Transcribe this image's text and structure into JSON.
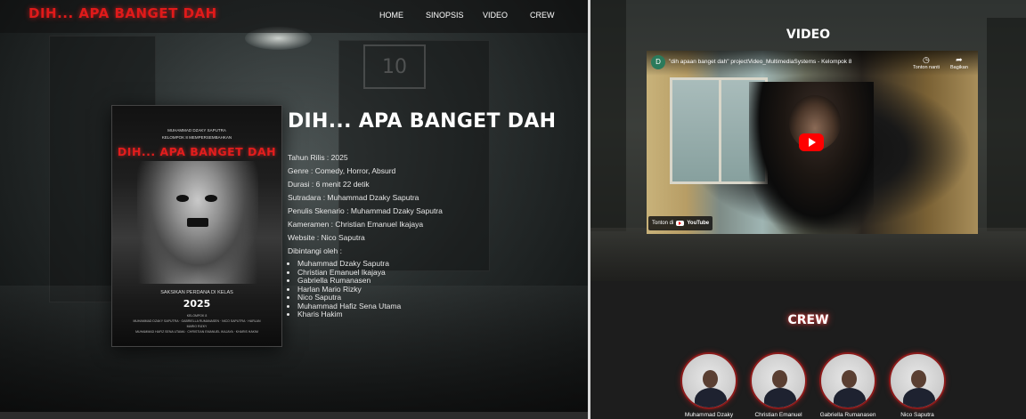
{
  "header": {
    "logo": "DIH... APA BANGET DAH",
    "nav": [
      "HOME",
      "SINOPSIS",
      "VIDEO",
      "CREW"
    ]
  },
  "corridor_sign": "10",
  "poster": {
    "top_line_1": "MUHAMMAD DZAKY SAPUTRA",
    "top_line_2": "KELOMPOK 8 MEMPERSEMBAHKAN",
    "title": "DIH... APA BANGET DAH",
    "subtitle": "SAKSIKAN PERDANA DI KELAS",
    "year": "2025",
    "credits_1": "KELOMPOK 8",
    "credits_2": "MUHAMMAD DZAKY SAPUTRA · GABRIELLA RUMANASEN · NICO SAPUTRA · HARLAN MARIO RIZKY",
    "credits_3": "MUHAMMAD HAFIZ SENA UTAMA · CHRISTIAN EMANUEL IKAJAYA · KHARIS HAKIM"
  },
  "film": {
    "title": "DIH... APA BANGET DAH",
    "details": [
      "Tahun Rilis : 2025",
      "Genre : Comedy, Horror, Absurd",
      "Durasi : 6 menit 22 detik",
      "Sutradara : Muhammad Dzaky Saputra",
      "Penulis Skenario : Muhammad Dzaky Saputra",
      "Kameramen : Christian Emanuel Ikajaya",
      "Website : Nico Saputra",
      "Dibintangi oleh :"
    ],
    "cast": [
      "Muhammad Dzaky Saputra",
      "Christian Emanuel Ikajaya",
      "Gabriella Rumanasen",
      "Harlan Mario Rizky",
      "Nico Saputra",
      "Muhammad Hafiz Sena Utama",
      "Kharis Hakim"
    ]
  },
  "video": {
    "heading": "VIDEO",
    "channel_initial": "D",
    "title": "\"dih apaan banget dah\" projectVideo_MultimediaSystems - Kelompok 8",
    "watch_later": "Tonton nanti",
    "share": "Bagikan",
    "watch_on": "Tonton di",
    "youtube": "YouTube"
  },
  "crew": {
    "heading": "CREW",
    "members": [
      "Muhammad Dzaky",
      "Christian Emanuel",
      "Gabriella Rumanasen",
      "Nico Saputra"
    ]
  },
  "colors": {
    "logo_red": "#e01a1a",
    "youtube_red": "#ff0000",
    "crew_ring": "#8b1a1a"
  }
}
